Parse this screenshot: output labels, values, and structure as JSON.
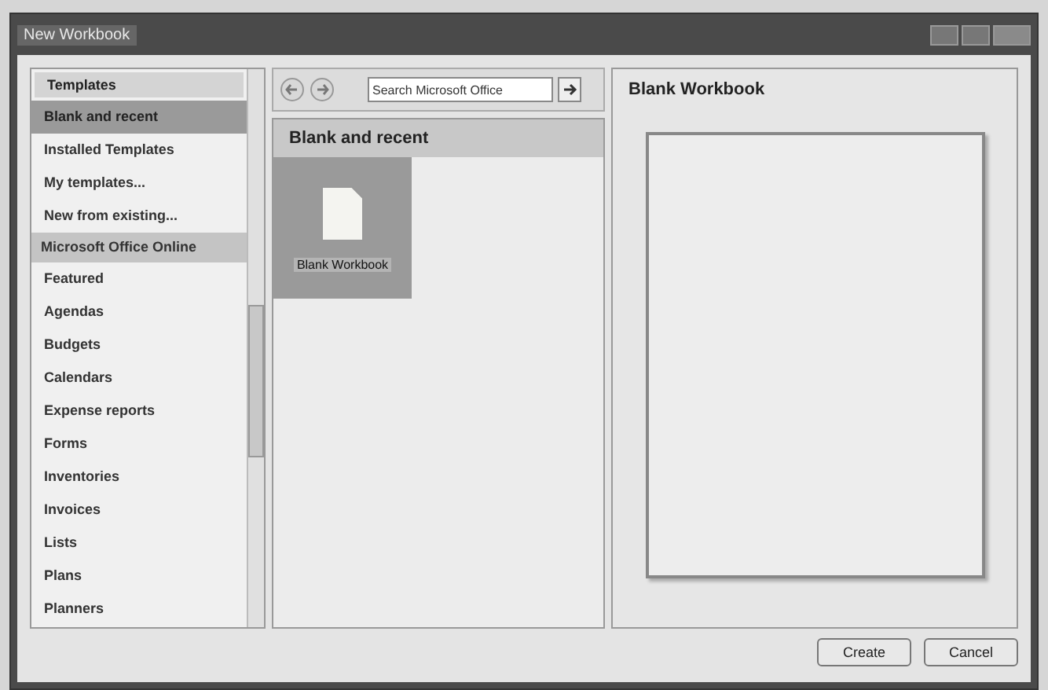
{
  "window": {
    "title": "New Workbook"
  },
  "sidebar": {
    "items": [
      {
        "kind": "header",
        "label": "Templates",
        "selected": false
      },
      {
        "kind": "item",
        "label": "Blank and recent",
        "selected": true
      },
      {
        "kind": "item",
        "label": "Installed Templates",
        "selected": false
      },
      {
        "kind": "item",
        "label": "My templates...",
        "selected": false
      },
      {
        "kind": "item",
        "label": "New from existing...",
        "selected": false
      },
      {
        "kind": "group",
        "label": "Microsoft Office Online",
        "selected": false
      },
      {
        "kind": "item",
        "label": "Featured",
        "selected": false
      },
      {
        "kind": "item",
        "label": "Agendas",
        "selected": false
      },
      {
        "kind": "item",
        "label": "Budgets",
        "selected": false
      },
      {
        "kind": "item",
        "label": "Calendars",
        "selected": false
      },
      {
        "kind": "item",
        "label": "Expense reports",
        "selected": false
      },
      {
        "kind": "item",
        "label": "Forms",
        "selected": false
      },
      {
        "kind": "item",
        "label": "Inventories",
        "selected": false
      },
      {
        "kind": "item",
        "label": "Invoices",
        "selected": false
      },
      {
        "kind": "item",
        "label": "Lists",
        "selected": false
      },
      {
        "kind": "item",
        "label": "Plans",
        "selected": false
      },
      {
        "kind": "item",
        "label": "Planners",
        "selected": false
      }
    ]
  },
  "gallery": {
    "search": {
      "placeholder": "Search Microsoft Office"
    },
    "heading": "Blank and recent",
    "tiles": [
      {
        "label": "Blank Workbook",
        "selected": true
      }
    ]
  },
  "preview": {
    "title": "Blank Workbook"
  },
  "buttons": [
    "Create",
    "Cancel"
  ]
}
